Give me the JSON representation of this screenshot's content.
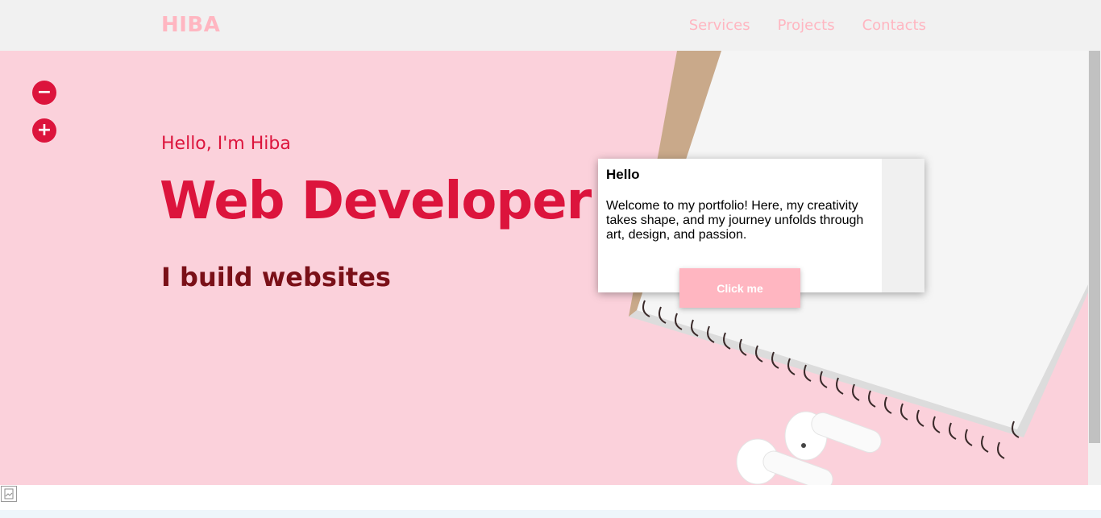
{
  "header": {
    "logo": "HIBA",
    "nav": [
      "Services",
      "Projects",
      "Contacts"
    ]
  },
  "zoom": {
    "minus_label": "−",
    "plus_label": "+"
  },
  "hero": {
    "greeting": "Hello, I'm Hiba",
    "headline": "Web Developer",
    "subline": "I build websites"
  },
  "popup": {
    "title": "Hello",
    "text": "Welcome to my portfolio! Here, my creativity takes shape, and my journey unfolds through art, design, and passion.",
    "button_label": "Click me"
  },
  "colors": {
    "accent": "#dc143c",
    "logo_pink": "#ffb6c1",
    "hero_bg": "#fbd1db",
    "subline": "#7a1018"
  },
  "icons": {
    "zoom_out": "minus-icon",
    "zoom_in": "plus-icon",
    "broken_image": "broken-image-icon"
  }
}
